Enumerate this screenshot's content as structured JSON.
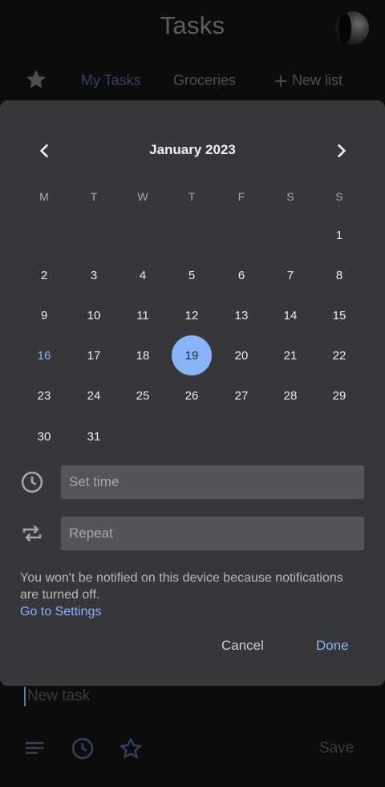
{
  "app": {
    "title": "Tasks"
  },
  "tabs": {
    "items": [
      {
        "label": "My Tasks",
        "active": true
      },
      {
        "label": "Groceries",
        "active": false
      }
    ],
    "new_list_label": "New list"
  },
  "calendar": {
    "month_label": "January 2023",
    "weekdays": [
      "M",
      "T",
      "W",
      "T",
      "F",
      "S",
      "S"
    ],
    "first_weekday_index": 6,
    "days_in_month": 31,
    "today": 16,
    "selected": 19
  },
  "time_field": {
    "placeholder": "Set time"
  },
  "repeat_field": {
    "placeholder": "Repeat"
  },
  "notice": {
    "text": "You won't be notified on this device because notifications are turned off.",
    "link_label": "Go to Settings"
  },
  "dialog_buttons": {
    "cancel_label": "Cancel",
    "done_label": "Done"
  },
  "task": {
    "placeholder": "New task"
  },
  "bottom_bar": {
    "save_label": "Save"
  },
  "colors": {
    "accent": "#8ab4f8",
    "dialog_bg": "#36373b",
    "field_bg": "#54555a",
    "background": "#0c0c0c"
  }
}
